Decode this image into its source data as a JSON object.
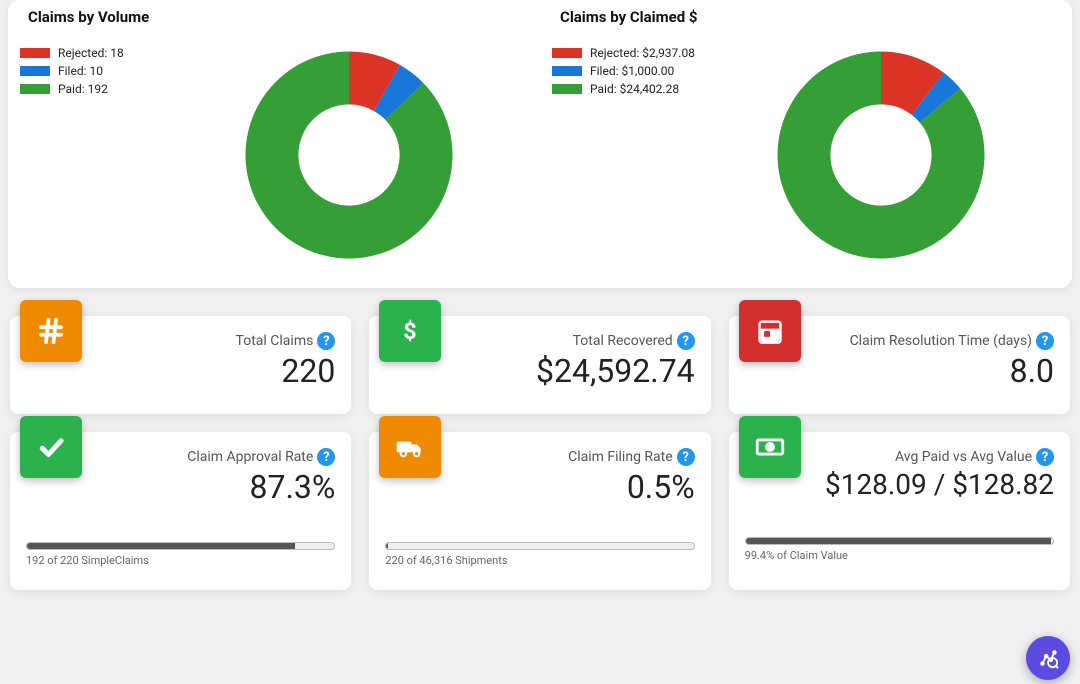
{
  "chart_data": [
    {
      "type": "pie",
      "title": "Claims by Volume",
      "series": [
        {
          "name": "Rejected",
          "value": 18,
          "label": "18",
          "color": "#dc3327"
        },
        {
          "name": "Filed",
          "value": 10,
          "label": "10",
          "color": "#1877d8"
        },
        {
          "name": "Paid",
          "value": 192,
          "label": "192",
          "color": "#359e36"
        }
      ],
      "donut": true
    },
    {
      "type": "pie",
      "title": "Claims by Claimed $",
      "series": [
        {
          "name": "Rejected",
          "value": 2937.08,
          "label": "$2,937.08",
          "color": "#dc3327"
        },
        {
          "name": "Filed",
          "value": 1000.0,
          "label": "$1,000.00",
          "color": "#1877d8"
        },
        {
          "name": "Paid",
          "value": 24402.28,
          "label": "$24,402.28",
          "color": "#359e36"
        }
      ],
      "donut": true
    }
  ],
  "metrics": {
    "total_claims": {
      "title": "Total Claims",
      "value": "220"
    },
    "total_recovered": {
      "title": "Total Recovered",
      "value": "$24,592.74"
    },
    "resolution": {
      "title": "Claim Resolution Time (days)",
      "value": "8.0"
    },
    "approval": {
      "title": "Claim Approval Rate",
      "value": "87.3%",
      "caption": "192 of 220 SimpleClaims",
      "progress": 87.3
    },
    "filing": {
      "title": "Claim Filing Rate",
      "value": "0.5%",
      "caption": "220 of 46,316 Shipments",
      "progress": 0.5
    },
    "avg": {
      "title": "Avg Paid vs Avg Value",
      "value": "$128.09 / $128.82",
      "caption": "99.4% of Claim Value",
      "progress": 99.4
    }
  }
}
